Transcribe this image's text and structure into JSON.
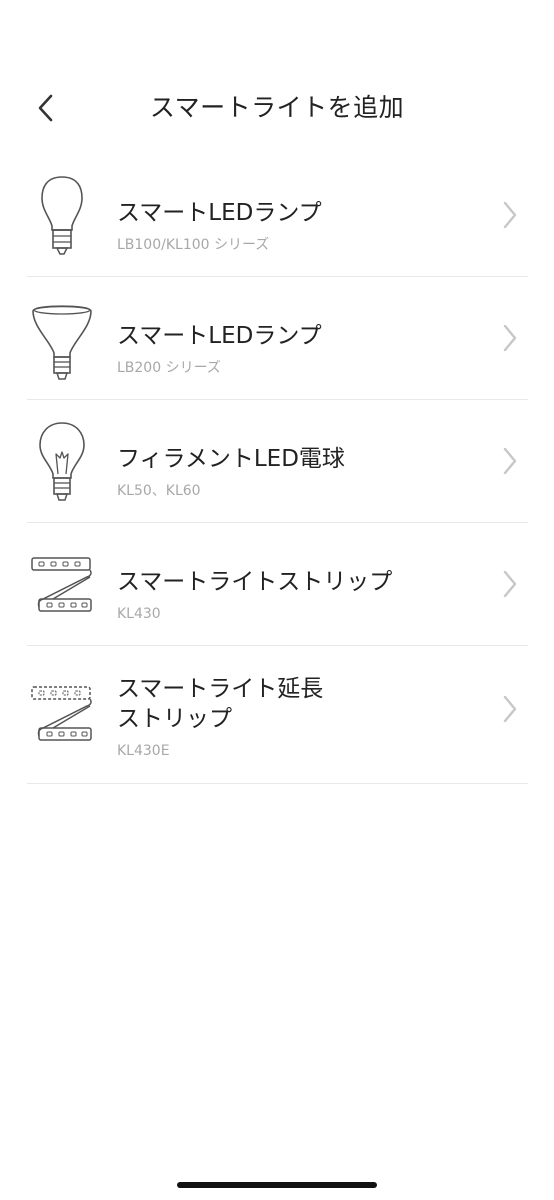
{
  "header": {
    "title": "スマートライトを追加",
    "back_icon": "chevron-left-icon"
  },
  "devices": [
    {
      "title": "スマートLEDランプ",
      "subtitle": "LB100/KL100 シリーズ",
      "icon": "a19-bulb-icon"
    },
    {
      "title": "スマートLEDランプ",
      "subtitle": "LB200 シリーズ",
      "icon": "br30-flood-bulb-icon"
    },
    {
      "title": "フィラメントLED電球",
      "subtitle": "KL50、KL60",
      "icon": "filament-bulb-icon"
    },
    {
      "title": "スマートライトストリップ",
      "subtitle": "KL430",
      "icon": "light-strip-icon"
    },
    {
      "title": "スマートライト延長\nストリップ",
      "subtitle": "KL430E",
      "icon": "light-strip-extension-icon"
    }
  ],
  "colors": {
    "text_primary": "#222222",
    "text_secondary": "#a8a8a8",
    "divider": "#e8e8e8",
    "chevron": "#c7c7c7"
  }
}
